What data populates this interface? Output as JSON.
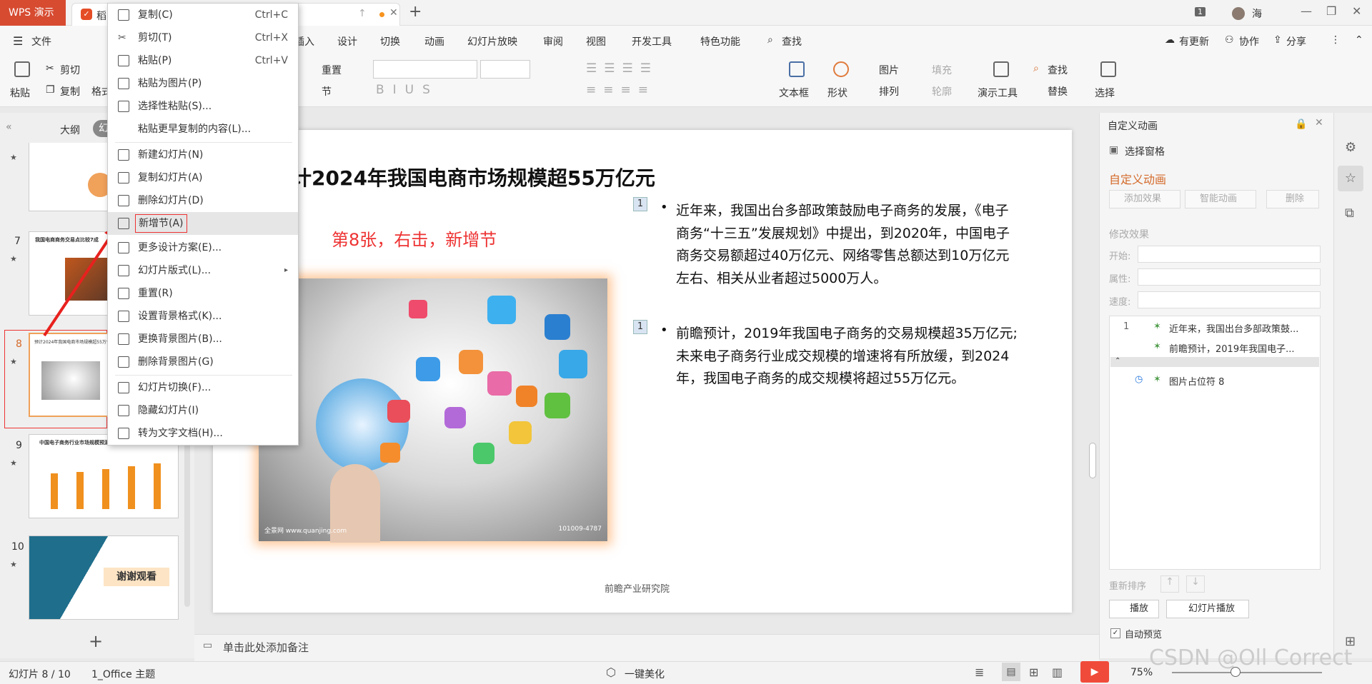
{
  "titlebar": {
    "app_tab": "WPS 演示",
    "doc_tab": "稻",
    "page_badge": "1",
    "user": "海"
  },
  "menus": [
    "文件",
    "插入",
    "设计",
    "切换",
    "动画",
    "幻灯片放映",
    "审阅",
    "视图",
    "开发工具",
    "特色功能",
    "查找"
  ],
  "menu_right": {
    "update": "有更新",
    "collab": "协作",
    "share": "分享"
  },
  "ribbon": {
    "paste": "粘贴",
    "cut": "剪切",
    "copy": "复制",
    "format": "格式",
    "reset": "重置",
    "section": "节",
    "textbox": "文本框",
    "shape": "形状",
    "arrange": "排列",
    "picture": "图片",
    "fill": "填充",
    "outline": "轮廓",
    "present_tools": "演示工具",
    "find": "查找",
    "replace": "替换",
    "select": "选择"
  },
  "left_panel": {
    "tab_outline": "大纲",
    "tab_slides": "幻",
    "add": "+"
  },
  "thumbnails": [
    {
      "num": "7",
      "title": "我国电商商务交易点比较7成"
    },
    {
      "num": "8",
      "title": "预计2024年我国电商市场规模超55万亿元"
    },
    {
      "num": "9",
      "title": "中国电子商务行业市场规模预测"
    },
    {
      "num": "10",
      "title": "谢谢观看"
    }
  ],
  "context_menu": [
    {
      "label": "复制(C)",
      "shortcut": "Ctrl+C"
    },
    {
      "label": "剪切(T)",
      "shortcut": "Ctrl+X"
    },
    {
      "label": "粘贴(P)",
      "shortcut": "Ctrl+V"
    },
    {
      "label": "粘贴为图片(P)",
      "shortcut": ""
    },
    {
      "label": "选择性粘贴(S)...",
      "shortcut": ""
    },
    {
      "label": "粘贴更早复制的内容(L)...",
      "shortcut": ""
    },
    {
      "label": "新建幻灯片(N)",
      "shortcut": ""
    },
    {
      "label": "复制幻灯片(A)",
      "shortcut": ""
    },
    {
      "label": "删除幻灯片(D)",
      "shortcut": ""
    },
    {
      "label": "新增节(A)",
      "shortcut": ""
    },
    {
      "label": "更多设计方案(E)...",
      "shortcut": ""
    },
    {
      "label": "幻灯片版式(L)...",
      "shortcut": ""
    },
    {
      "label": "重置(R)",
      "shortcut": ""
    },
    {
      "label": "设置背景格式(K)...",
      "shortcut": ""
    },
    {
      "label": "更换背景图片(B)...",
      "shortcut": ""
    },
    {
      "label": "删除背景图片(G)",
      "shortcut": ""
    },
    {
      "label": "幻灯片切换(F)...",
      "shortcut": ""
    },
    {
      "label": "隐藏幻灯片(I)",
      "shortcut": ""
    },
    {
      "label": "转为文字文档(H)...",
      "shortcut": ""
    }
  ],
  "slide": {
    "title": "计2024年我国电商市场规模超55万亿元",
    "annotation": "第8张，右击，新增节",
    "bullet1": "近年来，我国出台多部政策鼓励电子商务的发展，《电子商务“十三五”发展规划》中提出，到2020年，中国电子商务交易额超过40万亿元、网络零售总额达到10万亿元左右、相关从业者超过5000万人。",
    "bullet2": "前瞻预计，2019年我国电子商务的交易规模超35万亿元;未来电子商务行业成交规模的增速将有所放缓，到2024年，我国电子商务的成交规模将超过55万亿元。",
    "anim_tag": "1",
    "source": "前瞻产业研究院",
    "img_wm_left": "全景网 www.quanjing.com",
    "img_wm_right": "101009-4787"
  },
  "right_panel": {
    "header": "自定义动画",
    "select_pane": "选择窗格",
    "section": "自定义动画",
    "add_effect": "添加效果",
    "smart_anim": "智能动画",
    "delete": "删除",
    "modify": "修改效果",
    "start": "开始:",
    "property": "属性:",
    "speed": "速度:",
    "list": [
      {
        "num": "1",
        "text": "近年来，我国出台多部政策鼓..."
      },
      {
        "num": "",
        "text": "前瞻预计，2019年我国电子..."
      },
      {
        "num": "",
        "text": "图片占位符 8"
      }
    ],
    "reorder": "重新排序",
    "play": "播放",
    "slideshow": "幻灯片播放",
    "autopreview": "自动预览"
  },
  "notes": "单击此处添加备注",
  "status": {
    "slide": "幻灯片 8 / 10",
    "theme": "1_Office 主题",
    "beautify": "一键美化",
    "zoom": "75%",
    "watermark": "CSDN @Oll Correct"
  }
}
